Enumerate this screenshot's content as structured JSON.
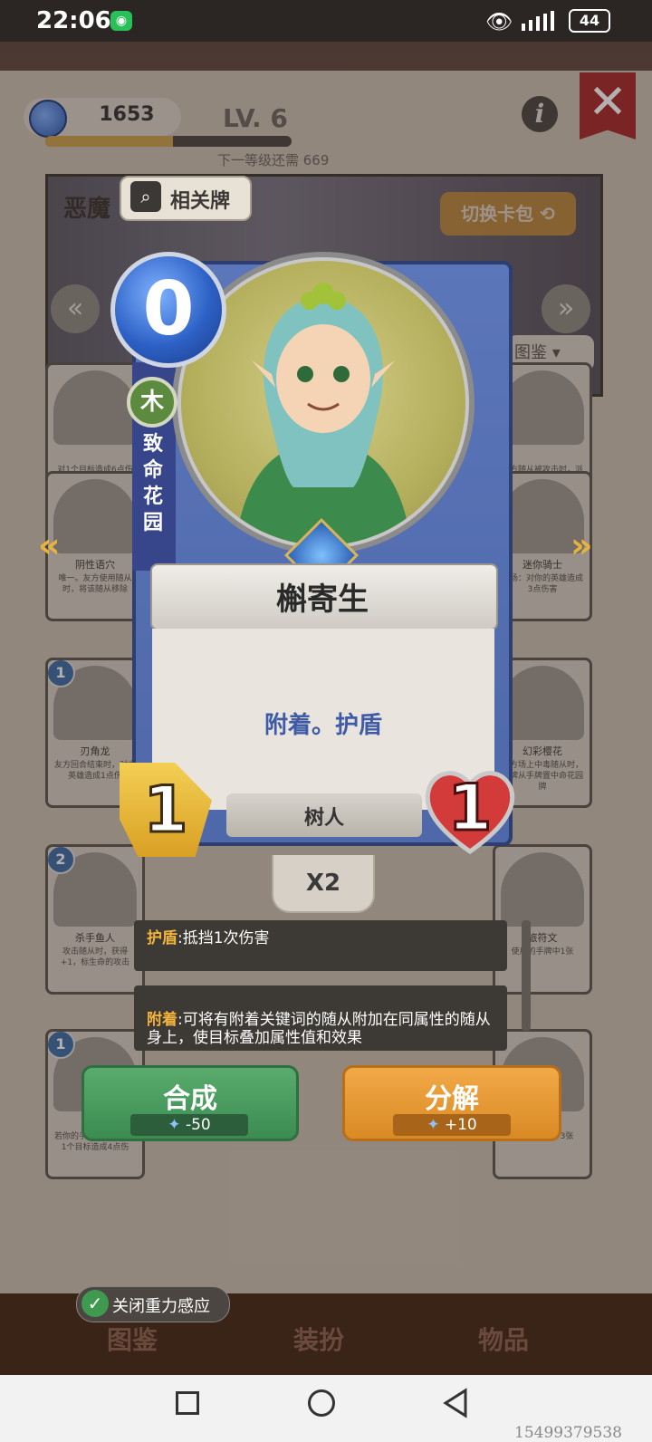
{
  "status_bar": {
    "time": "22:06",
    "battery": "44"
  },
  "header": {
    "gems": "1653",
    "level": "LV. 6",
    "xp_progress": 0.52,
    "next_level_text": "下一等级还需 669",
    "info_glyph": "i",
    "close_glyph": "✕"
  },
  "banner": {
    "title": "恶魔",
    "related_button": "相关牌",
    "switch_pack": "切换卡包 ⟲",
    "encyclopedia": "图鉴 ▾"
  },
  "card": {
    "cost": "0",
    "element": "木",
    "set_name": "致命花园",
    "name": "槲寄生",
    "ability": "附着。护盾",
    "type": "树人",
    "attack": "1",
    "health": "1",
    "copies": "X2"
  },
  "keywords": [
    {
      "term": "护盾",
      "desc": ":抵挡1次伤害"
    },
    {
      "term": "附着",
      "desc": ":可将有附着关键词的随从附加在同属性的随从身上，使目标叠加属性值和效果"
    }
  ],
  "actions": {
    "compose_label": "合成",
    "compose_cost": "-50",
    "decompose_label": "分解",
    "decompose_cost": "+10"
  },
  "grid_cards": [
    {
      "cost": "",
      "name": "",
      "desc": "对1个目标造成6点伤"
    },
    {
      "cost": "",
      "name": "",
      "desc": "友方随从被攻击时，派出双倍"
    },
    {
      "cost": "",
      "name": "阴性语穴",
      "desc": "唯一。友方使用随从时，将该随从移除"
    },
    {
      "cost": "",
      "name": "迷你骑士",
      "desc": "登场：对你的英雄造成3点伤害"
    },
    {
      "cost": "1",
      "name": "刃角龙",
      "desc": "友方回合结束时，对方英雄造成1点伤"
    },
    {
      "cost": "",
      "name": "幻彩樱花",
      "desc": "友方场上中毒随从时，本牌从手牌置中命花园牌"
    },
    {
      "cost": "2",
      "name": "杀手鱼人",
      "desc": "攻击随从时，获得+1，标生命的攻击"
    },
    {
      "cost": "",
      "name": "旅符文",
      "desc": "使用的手牌中1张"
    },
    {
      "cost": "1",
      "name": "",
      "desc": "若你的手牌中此时，对1个目标造成4点伤"
    },
    {
      "cost": "",
      "name": "",
      "desc": "格对方场上中3张"
    }
  ],
  "side_nav": {
    "left": "«",
    "right": "»"
  },
  "gravity": {
    "check": "✓",
    "label": "关闭重力感应"
  },
  "bottom_tabs": [
    "图鉴",
    "装扮",
    "物品"
  ],
  "watermark": "15499379538"
}
